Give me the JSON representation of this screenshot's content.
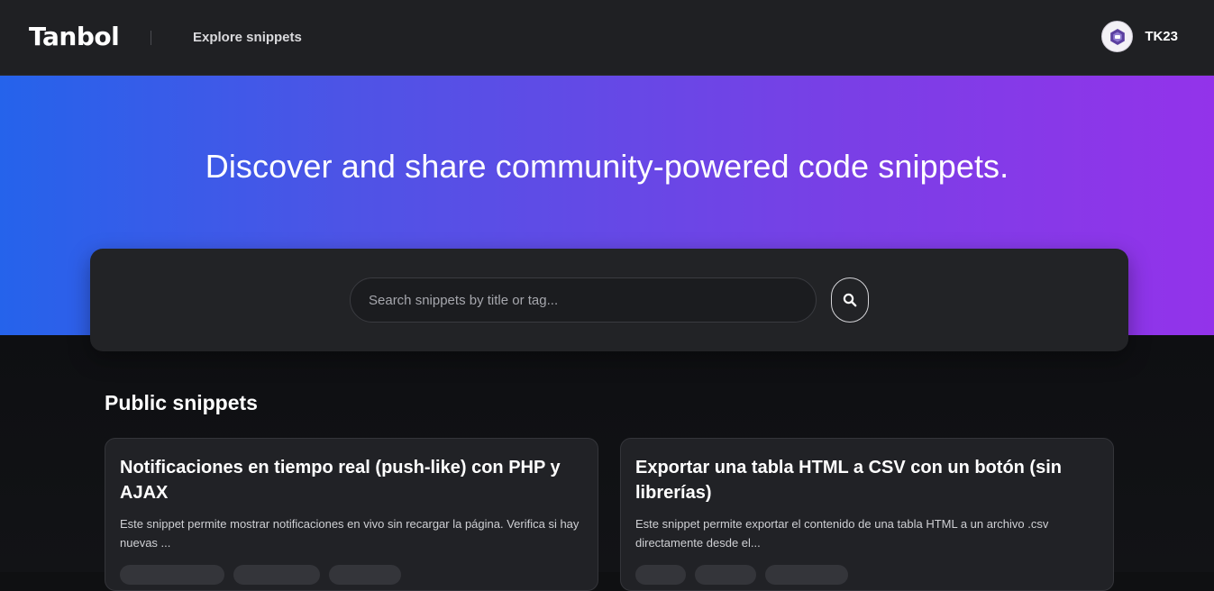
{
  "header": {
    "brand": "Tanbol",
    "nav_link": "Explore snippets",
    "user_name": "TK23"
  },
  "hero": {
    "title": "Discover and share community-powered code snippets."
  },
  "search": {
    "placeholder": "Search snippets by title or tag...",
    "value": ""
  },
  "section": {
    "title": "Public snippets"
  },
  "snippets": [
    {
      "title": "Notificaciones en tiempo real (push-like) con PHP y AJAX",
      "description": "Este snippet permite mostrar notificaciones en vivo sin recargar la página. Verifica si hay nuevas ...",
      "tags": [
        "",
        "",
        ""
      ]
    },
    {
      "title": "Exportar una tabla HTML a CSV con un botón (sin librerías)",
      "description": "Este snippet permite exportar el contenido de una tabla HTML a un archivo .csv directamente desde el...",
      "tags": [
        "",
        "",
        ""
      ]
    }
  ],
  "colors": {
    "gradient_start": "#2563eb",
    "gradient_end": "#9333ea",
    "header_bg": "#1f2023",
    "card_bg": "#212226"
  },
  "icons": {
    "search": "search-icon",
    "avatar": "avatar-logo-icon"
  }
}
